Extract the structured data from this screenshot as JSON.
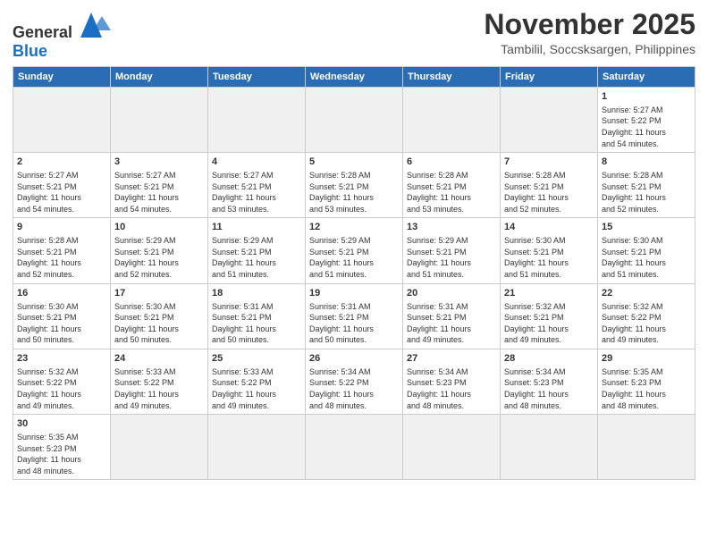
{
  "header": {
    "logo_general": "General",
    "logo_blue": "Blue",
    "month_title": "November 2025",
    "location": "Tambilil, Soccsksargen, Philippines"
  },
  "days_of_week": [
    "Sunday",
    "Monday",
    "Tuesday",
    "Wednesday",
    "Thursday",
    "Friday",
    "Saturday"
  ],
  "weeks": [
    [
      {
        "num": "",
        "info": ""
      },
      {
        "num": "",
        "info": ""
      },
      {
        "num": "",
        "info": ""
      },
      {
        "num": "",
        "info": ""
      },
      {
        "num": "",
        "info": ""
      },
      {
        "num": "",
        "info": ""
      },
      {
        "num": "1",
        "info": "Sunrise: 5:27 AM\nSunset: 5:22 PM\nDaylight: 11 hours\nand 54 minutes."
      }
    ],
    [
      {
        "num": "2",
        "info": "Sunrise: 5:27 AM\nSunset: 5:21 PM\nDaylight: 11 hours\nand 54 minutes."
      },
      {
        "num": "3",
        "info": "Sunrise: 5:27 AM\nSunset: 5:21 PM\nDaylight: 11 hours\nand 54 minutes."
      },
      {
        "num": "4",
        "info": "Sunrise: 5:27 AM\nSunset: 5:21 PM\nDaylight: 11 hours\nand 53 minutes."
      },
      {
        "num": "5",
        "info": "Sunrise: 5:28 AM\nSunset: 5:21 PM\nDaylight: 11 hours\nand 53 minutes."
      },
      {
        "num": "6",
        "info": "Sunrise: 5:28 AM\nSunset: 5:21 PM\nDaylight: 11 hours\nand 53 minutes."
      },
      {
        "num": "7",
        "info": "Sunrise: 5:28 AM\nSunset: 5:21 PM\nDaylight: 11 hours\nand 52 minutes."
      },
      {
        "num": "8",
        "info": "Sunrise: 5:28 AM\nSunset: 5:21 PM\nDaylight: 11 hours\nand 52 minutes."
      }
    ],
    [
      {
        "num": "9",
        "info": "Sunrise: 5:28 AM\nSunset: 5:21 PM\nDaylight: 11 hours\nand 52 minutes."
      },
      {
        "num": "10",
        "info": "Sunrise: 5:29 AM\nSunset: 5:21 PM\nDaylight: 11 hours\nand 52 minutes."
      },
      {
        "num": "11",
        "info": "Sunrise: 5:29 AM\nSunset: 5:21 PM\nDaylight: 11 hours\nand 51 minutes."
      },
      {
        "num": "12",
        "info": "Sunrise: 5:29 AM\nSunset: 5:21 PM\nDaylight: 11 hours\nand 51 minutes."
      },
      {
        "num": "13",
        "info": "Sunrise: 5:29 AM\nSunset: 5:21 PM\nDaylight: 11 hours\nand 51 minutes."
      },
      {
        "num": "14",
        "info": "Sunrise: 5:30 AM\nSunset: 5:21 PM\nDaylight: 11 hours\nand 51 minutes."
      },
      {
        "num": "15",
        "info": "Sunrise: 5:30 AM\nSunset: 5:21 PM\nDaylight: 11 hours\nand 51 minutes."
      }
    ],
    [
      {
        "num": "16",
        "info": "Sunrise: 5:30 AM\nSunset: 5:21 PM\nDaylight: 11 hours\nand 50 minutes."
      },
      {
        "num": "17",
        "info": "Sunrise: 5:30 AM\nSunset: 5:21 PM\nDaylight: 11 hours\nand 50 minutes."
      },
      {
        "num": "18",
        "info": "Sunrise: 5:31 AM\nSunset: 5:21 PM\nDaylight: 11 hours\nand 50 minutes."
      },
      {
        "num": "19",
        "info": "Sunrise: 5:31 AM\nSunset: 5:21 PM\nDaylight: 11 hours\nand 50 minutes."
      },
      {
        "num": "20",
        "info": "Sunrise: 5:31 AM\nSunset: 5:21 PM\nDaylight: 11 hours\nand 49 minutes."
      },
      {
        "num": "21",
        "info": "Sunrise: 5:32 AM\nSunset: 5:21 PM\nDaylight: 11 hours\nand 49 minutes."
      },
      {
        "num": "22",
        "info": "Sunrise: 5:32 AM\nSunset: 5:22 PM\nDaylight: 11 hours\nand 49 minutes."
      }
    ],
    [
      {
        "num": "23",
        "info": "Sunrise: 5:32 AM\nSunset: 5:22 PM\nDaylight: 11 hours\nand 49 minutes."
      },
      {
        "num": "24",
        "info": "Sunrise: 5:33 AM\nSunset: 5:22 PM\nDaylight: 11 hours\nand 49 minutes."
      },
      {
        "num": "25",
        "info": "Sunrise: 5:33 AM\nSunset: 5:22 PM\nDaylight: 11 hours\nand 49 minutes."
      },
      {
        "num": "26",
        "info": "Sunrise: 5:34 AM\nSunset: 5:22 PM\nDaylight: 11 hours\nand 48 minutes."
      },
      {
        "num": "27",
        "info": "Sunrise: 5:34 AM\nSunset: 5:23 PM\nDaylight: 11 hours\nand 48 minutes."
      },
      {
        "num": "28",
        "info": "Sunrise: 5:34 AM\nSunset: 5:23 PM\nDaylight: 11 hours\nand 48 minutes."
      },
      {
        "num": "29",
        "info": "Sunrise: 5:35 AM\nSunset: 5:23 PM\nDaylight: 11 hours\nand 48 minutes."
      }
    ],
    [
      {
        "num": "30",
        "info": "Sunrise: 5:35 AM\nSunset: 5:23 PM\nDaylight: 11 hours\nand 48 minutes."
      },
      {
        "num": "",
        "info": ""
      },
      {
        "num": "",
        "info": ""
      },
      {
        "num": "",
        "info": ""
      },
      {
        "num": "",
        "info": ""
      },
      {
        "num": "",
        "info": ""
      },
      {
        "num": "",
        "info": ""
      }
    ]
  ]
}
